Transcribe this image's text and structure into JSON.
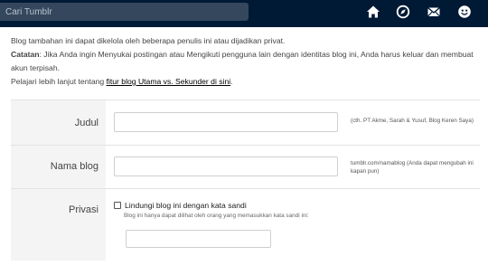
{
  "topbar": {
    "search_placeholder": "Cari Tumblr",
    "icons": [
      "home-icon",
      "compass-icon",
      "mail-icon",
      "account-icon"
    ],
    "background": "#001935",
    "search_background": "#34475d"
  },
  "info": {
    "line1": "Blog tambahan ini dapat dikelola oleh beberapa penulis ini atau dijadikan privat.",
    "caution_label": "Catatan",
    "caution_text": ": Jika Anda ingin Menyukai postingan atau Mengikuti pengguna lain dengan identitas blog ini, Anda harus keluar dan membuat akun terpisah.",
    "learn_prefix": "Pelajari lebih lanjut tentang ",
    "learn_link": "fitur blog Utama vs. Sekunder di sini",
    "learn_suffix": "."
  },
  "form": {
    "title": {
      "label": "Judul",
      "value": "",
      "hint": "(cth. PT Akme, Sarah & Yusuf, Blog Keren Saya)"
    },
    "blogname": {
      "label": "Nama blog",
      "value": "",
      "hint": "tumblr.com/namablog (Anda dapat mengubah ini kapan pun)"
    },
    "privacy": {
      "label": "Privasi",
      "checkbox_label": "Lindungi blog ini dengan kata sandi",
      "checkbox_checked": false,
      "note": "Blog ini hanya dapat dilihat oleh orang yang memasukkan kata sandi ini:",
      "password_value": ""
    }
  }
}
